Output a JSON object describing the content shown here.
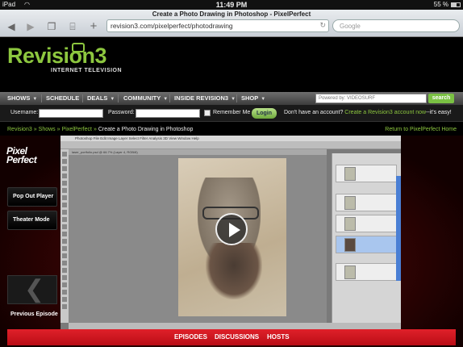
{
  "status_bar": {
    "device": "iPad",
    "time": "11:49 PM",
    "battery": "55 %"
  },
  "browser": {
    "page_title": "Create a Photo Drawing in Photoshop - PixelPerfect",
    "url": "revision3.com/pixelperfect/photodrawing",
    "search_placeholder": "Google"
  },
  "site": {
    "logo_word": "Revision3",
    "logo_sub": "INTERNET TELEVISION",
    "nav": [
      {
        "label": "SHOWS"
      },
      {
        "label": "SCHEDULE"
      },
      {
        "label": "DEALS"
      },
      {
        "label": "COMMUNITY"
      },
      {
        "label": "INSIDE REVISION3"
      },
      {
        "label": "SHOP"
      }
    ],
    "search_powered": "Powered by: VIDEOSURF",
    "search_button": "search",
    "login": {
      "username_label": "Username:",
      "password_label": "Password:",
      "remember_label": "Remember Me",
      "login_button": "Login",
      "no_account_text": "Don't have an account?",
      "create_link": "Create a Revision3 account now",
      "easy_text": "--it's easy!"
    },
    "breadcrumb": {
      "root": "Revision3",
      "shows": "Shows",
      "show": "PixelPerfect",
      "current": "Create a Photo Drawing in Photoshop",
      "separator": "»"
    },
    "return_link": "Return to PixelPerfect Home"
  },
  "player": {
    "show_logo": "Pixel Perfect",
    "pop_out": "Pop Out Player",
    "theater": "Theater Mode",
    "previous": "Previous Episode",
    "ps_menu": "Photoshop  File  Edit  Image  Layer  Select  Filter  Analysis  3D  View  Window  Help",
    "ps_doc_tab": "laser_portfolio.psd @ 66.7% (Layer 4, RGB/8)"
  },
  "tabs": [
    {
      "label": "EPISODES"
    },
    {
      "label": "DISCUSSIONS"
    },
    {
      "label": "HOSTS"
    }
  ]
}
